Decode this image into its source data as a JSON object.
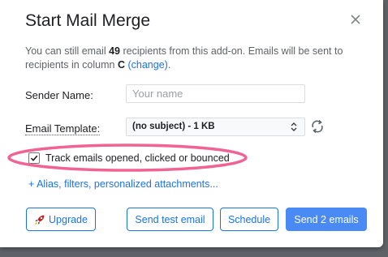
{
  "dialog": {
    "title": "Start Mail Merge",
    "close_icon": "close-icon"
  },
  "info": {
    "part1": "You can still email ",
    "count": "49",
    "part2": " recipients from this add-on. Emails will be sent to recipients in column ",
    "column": "C",
    "change_link": "(change)",
    "part3": "."
  },
  "form": {
    "sender_label": "Sender Name:",
    "sender_placeholder": "Your name",
    "sender_value": "",
    "template_label": "Email Template:",
    "template_value": "(no subject) - 1 KB",
    "refresh_icon": "refresh-icon"
  },
  "tracking": {
    "label": "Track emails opened, clicked or bounced",
    "checked": true,
    "highlight_color": "#f06392"
  },
  "more_options": "+ Alias, filters, personalized attachments...",
  "buttons": {
    "upgrade": "Upgrade",
    "upgrade_icon": "rocket-icon",
    "send_test": "Send test email",
    "schedule": "Schedule",
    "send": "Send 2 emails"
  },
  "colors": {
    "accent": "#1a73e8",
    "primary_button": "#4a8af4"
  }
}
